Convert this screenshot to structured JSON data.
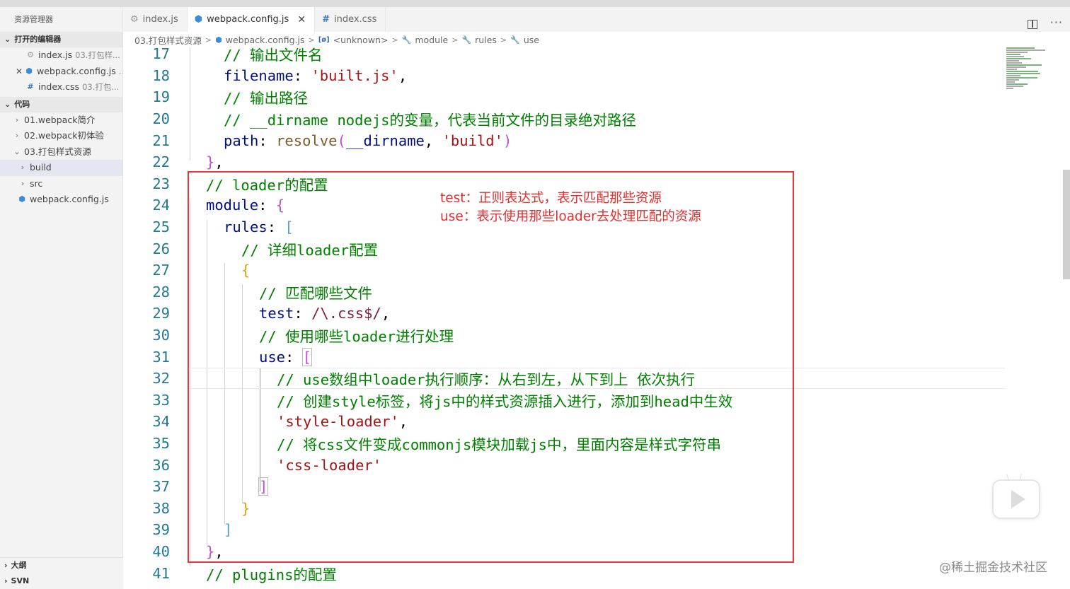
{
  "sidebar": {
    "title": "资源管理器",
    "open_editors": {
      "header": "打开的编辑器",
      "items": [
        {
          "name": "index.js",
          "path": "03.打包样..."
        },
        {
          "name": "webpack.config.js",
          "path": "..."
        },
        {
          "name": "index.css",
          "path": "03.打包..."
        }
      ]
    },
    "folder": {
      "header": "代码",
      "items": [
        {
          "label": "01.webpack简介"
        },
        {
          "label": "02.webpack初体验"
        },
        {
          "label": "03.打包样式资源"
        },
        {
          "label": "build"
        },
        {
          "label": "src"
        },
        {
          "label": "webpack.config.js"
        }
      ]
    },
    "outline_header": "大纲",
    "svn_header": "SVN"
  },
  "tabs": [
    {
      "label": "index.js"
    },
    {
      "label": "webpack.config.js"
    },
    {
      "label": "index.css"
    }
  ],
  "breadcrumb": {
    "folder": "03.打包样式资源",
    "file": "webpack.config.js",
    "unknown": "<unknown>",
    "module": "module",
    "rules": "rules",
    "use": "use"
  },
  "code": {
    "line_numbers": [
      "17",
      "18",
      "19",
      "20",
      "21",
      "22",
      "23",
      "24",
      "25",
      "26",
      "27",
      "28",
      "29",
      "30",
      "31",
      "32",
      "33",
      "34",
      "35",
      "36",
      "37",
      "38",
      "39",
      "40",
      "41"
    ],
    "l17": "// 输出文件名",
    "l18_key": "filename",
    "l18_str": "'built.js'",
    "l19": "// 输出路径",
    "l20": "// __dirname nodejs的变量，代表当前文件的目录绝对路径",
    "l21_key": "path",
    "l21_fn": "resolve",
    "l21_arg": "__dirname",
    "l21_str": "'build'",
    "l23": "// loader的配置",
    "l24_key": "module",
    "l25_key": "rules",
    "l26": "// 详细loader配置",
    "l28": "// 匹配哪些文件",
    "l29_key": "test",
    "l29_rx": "/\\.css$/",
    "l30": "// 使用哪些loader进行处理",
    "l31_key": "use",
    "l32": "// use数组中loader执行顺序：从右到左，从下到上 依次执行",
    "l33": "// 创建style标签，将js中的样式资源插入进行，添加到head中生效",
    "l34_str": "'style-loader'",
    "l35": "// 将css文件变成commonjs模块加载js中，里面内容是样式字符串",
    "l36_str": "'css-loader'",
    "l41": "// plugins的配置"
  },
  "annotation": {
    "line1": "test：正则表达式，表示匹配那些资源",
    "line2": "use：表示使用那些loader去处理匹配的资源"
  },
  "watermark": "@稀土掘金技术社区",
  "colors": {
    "comment": "#008000",
    "string": "#a31515",
    "property": "#001080",
    "annotation_red": "#e02f2f",
    "line_number": "#237893"
  }
}
